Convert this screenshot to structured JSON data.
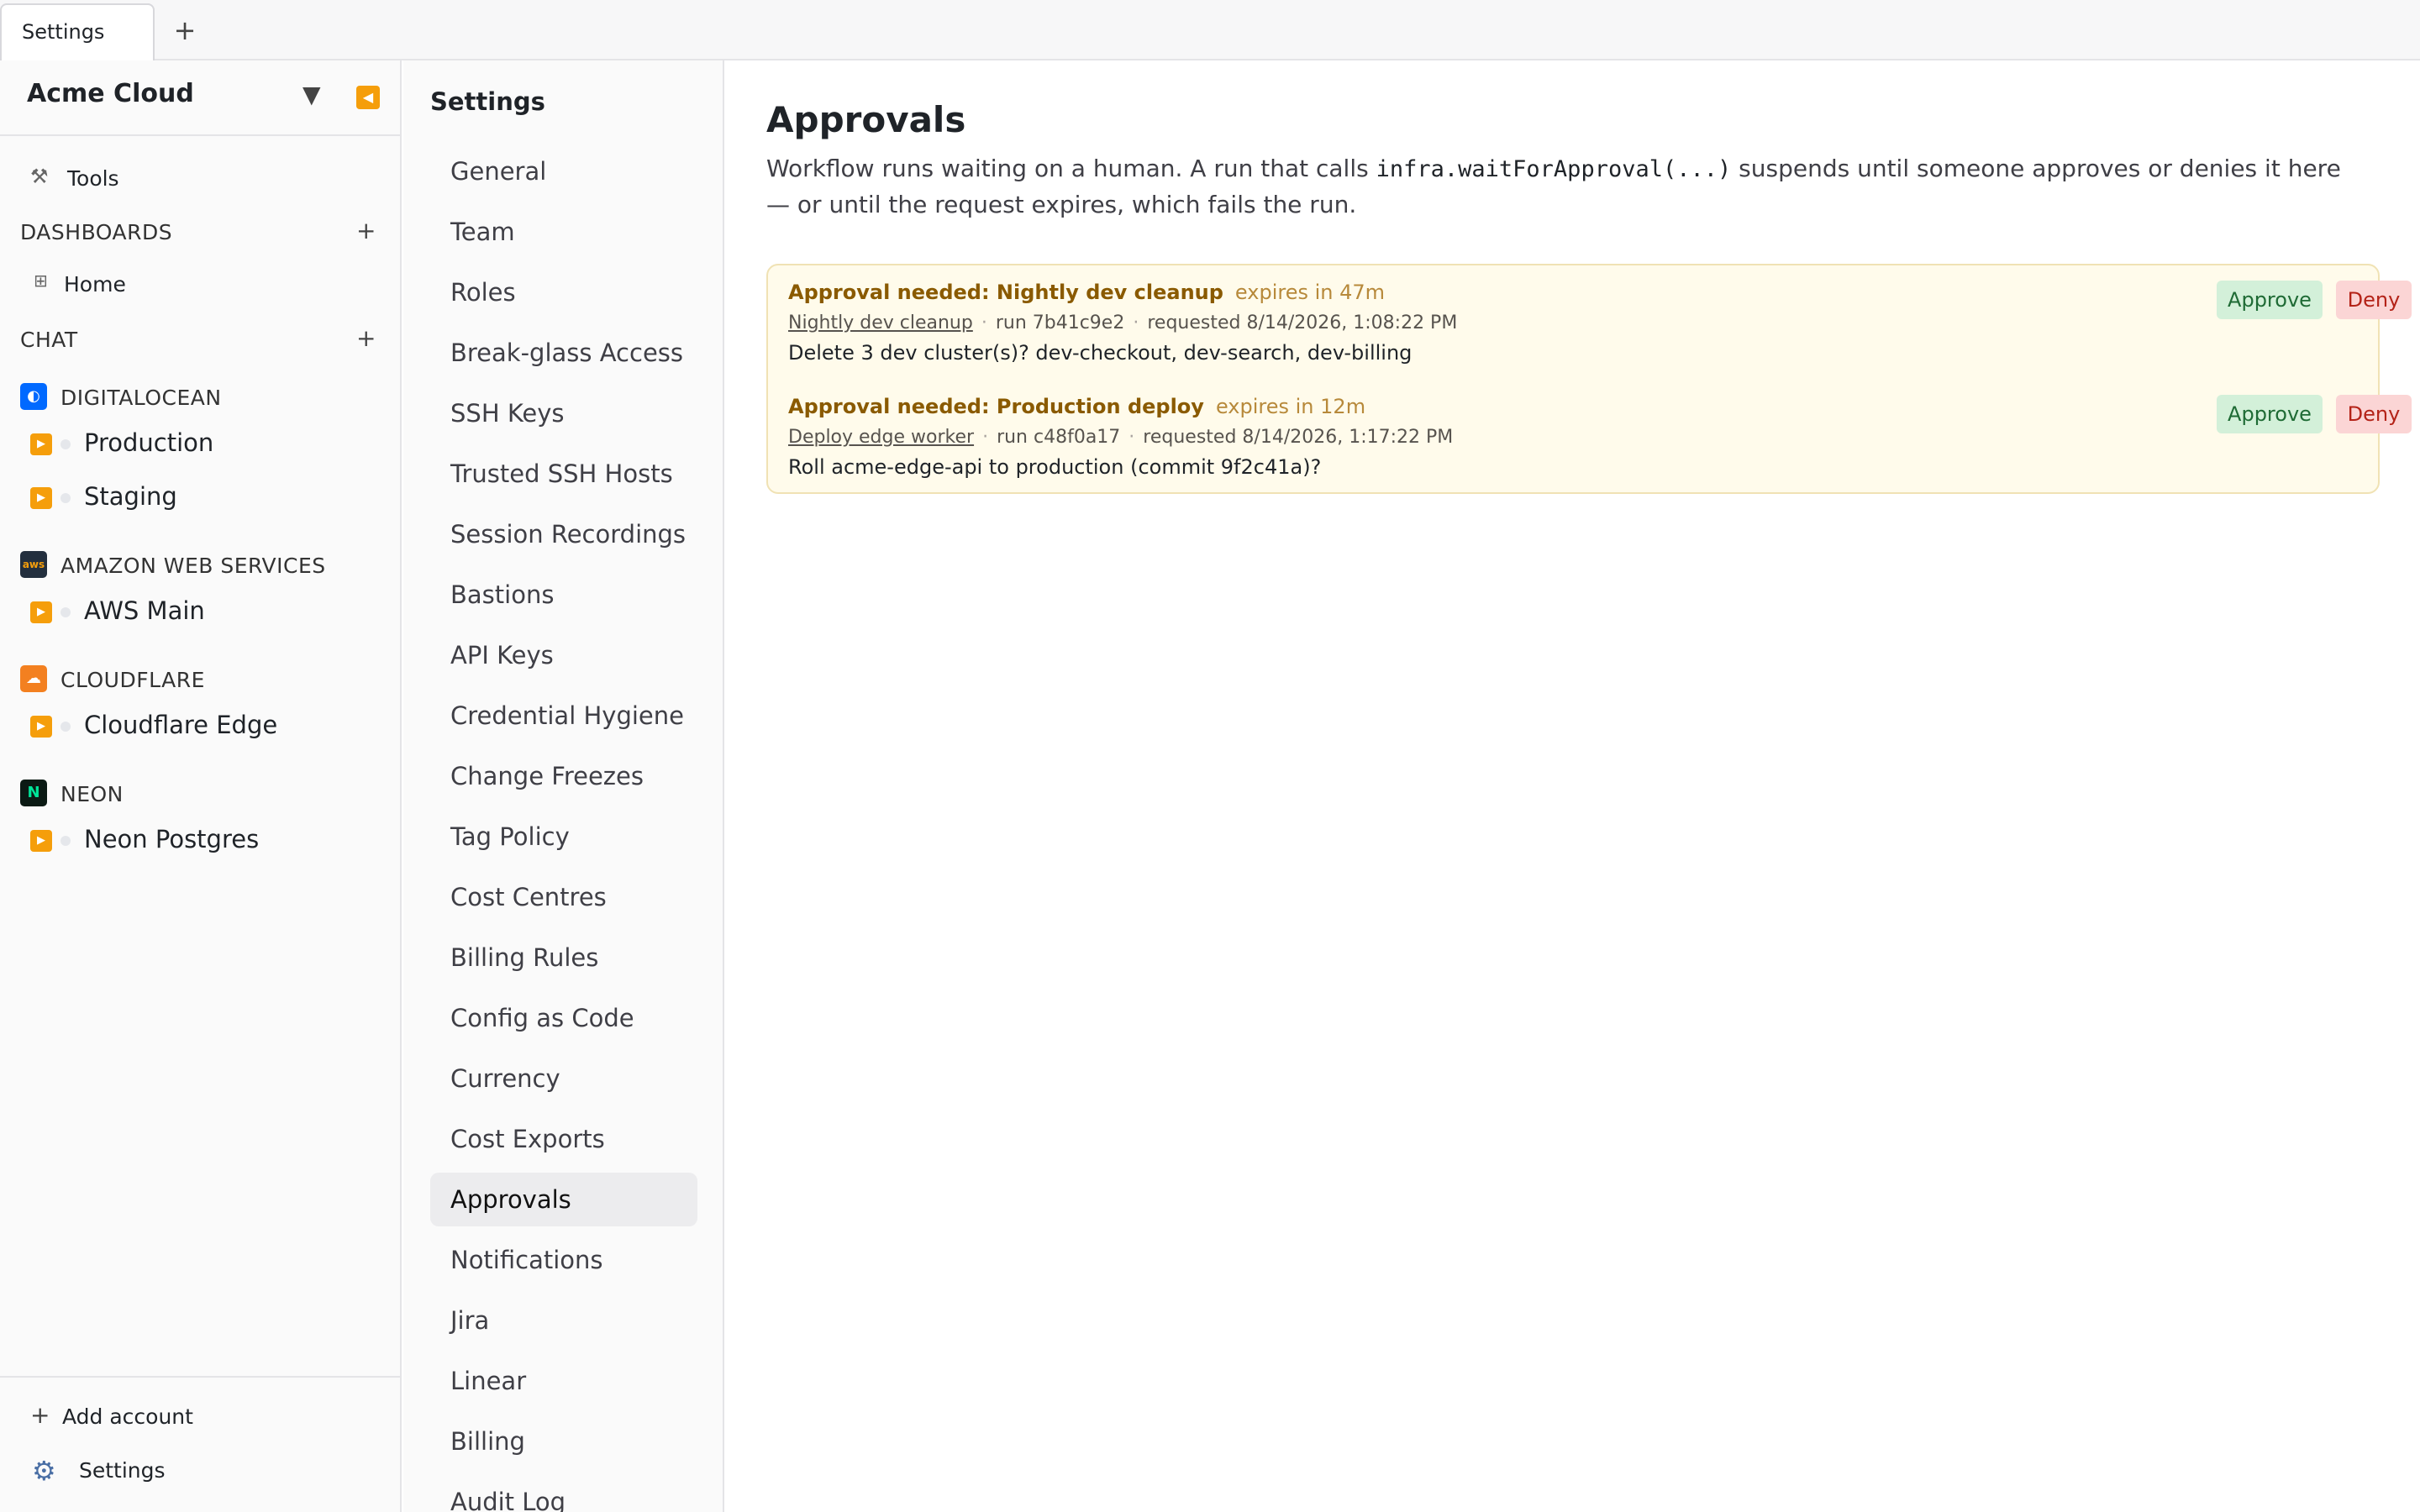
{
  "tabs": [
    {
      "label": "Settings"
    }
  ],
  "tab_add": "+",
  "sidebar": {
    "workspace": "Acme Cloud",
    "tools_label": "Tools",
    "dashboards_label": "DASHBOARDS",
    "dashboards_plus": "+",
    "home_label": "Home",
    "chat_label": "CHAT",
    "chat_plus": "+",
    "providers": [
      {
        "name": "DIGITALOCEAN",
        "icon": "digitalocean-icon",
        "color": "#0069ff",
        "accounts": [
          "Production",
          "Staging"
        ]
      },
      {
        "name": "AMAZON WEB SERVICES",
        "icon": "aws-icon",
        "color": "#232f3e",
        "accounts": [
          "AWS Main"
        ]
      },
      {
        "name": "CLOUDFLARE",
        "icon": "cloudflare-icon",
        "color": "#f38020",
        "accounts": [
          "Cloudflare Edge"
        ]
      },
      {
        "name": "NEON",
        "icon": "neon-icon",
        "color": "#00e599",
        "accounts": [
          "Neon Postgres"
        ]
      }
    ],
    "add_account": "Add account",
    "settings_label": "Settings"
  },
  "settings_nav": {
    "title": "Settings",
    "items": [
      "General",
      "Team",
      "Roles",
      "Break-glass Access",
      "SSH Keys",
      "Trusted SSH Hosts",
      "Session Recordings",
      "Bastions",
      "API Keys",
      "Credential Hygiene",
      "Change Freezes",
      "Tag Policy",
      "Cost Centres",
      "Billing Rules",
      "Config as Code",
      "Currency",
      "Cost Exports",
      "Approvals",
      "Notifications",
      "Jira",
      "Linear",
      "Billing",
      "Audit Log"
    ],
    "active": "Approvals"
  },
  "main": {
    "title": "Approvals",
    "desc_before": "Workflow runs waiting on a human. A run that calls ",
    "desc_code": "infra.waitForApproval(...)",
    "desc_after": " suspends until someone approves or denies it here — or until the request expires, which fails the run.",
    "approvals": [
      {
        "title": "Approval needed: Nightly dev cleanup",
        "expires": "expires in 47m",
        "workflow": "Nightly dev cleanup",
        "run": "run 7b41c9e2",
        "requested": "requested 8/14/2026, 1:08:22 PM",
        "body": "Delete 3 dev cluster(s)? dev-checkout, dev-search, dev-billing",
        "approve": "Approve",
        "deny": "Deny"
      },
      {
        "title": "Approval needed: Production deploy",
        "expires": "expires in 12m",
        "workflow": "Deploy edge worker",
        "run": "run c48f0a17",
        "requested": "requested 8/14/2026, 1:17:22 PM",
        "body": "Roll acme-edge-api to production (commit 9f2c41a)?",
        "approve": "Approve",
        "deny": "Deny"
      }
    ],
    "separator": "·"
  },
  "colors": {
    "accent": "#f59e0b",
    "approve_bg": "#d3f0d9",
    "deny_bg": "#fbd5d5",
    "card_bg": "#fffbeb"
  }
}
